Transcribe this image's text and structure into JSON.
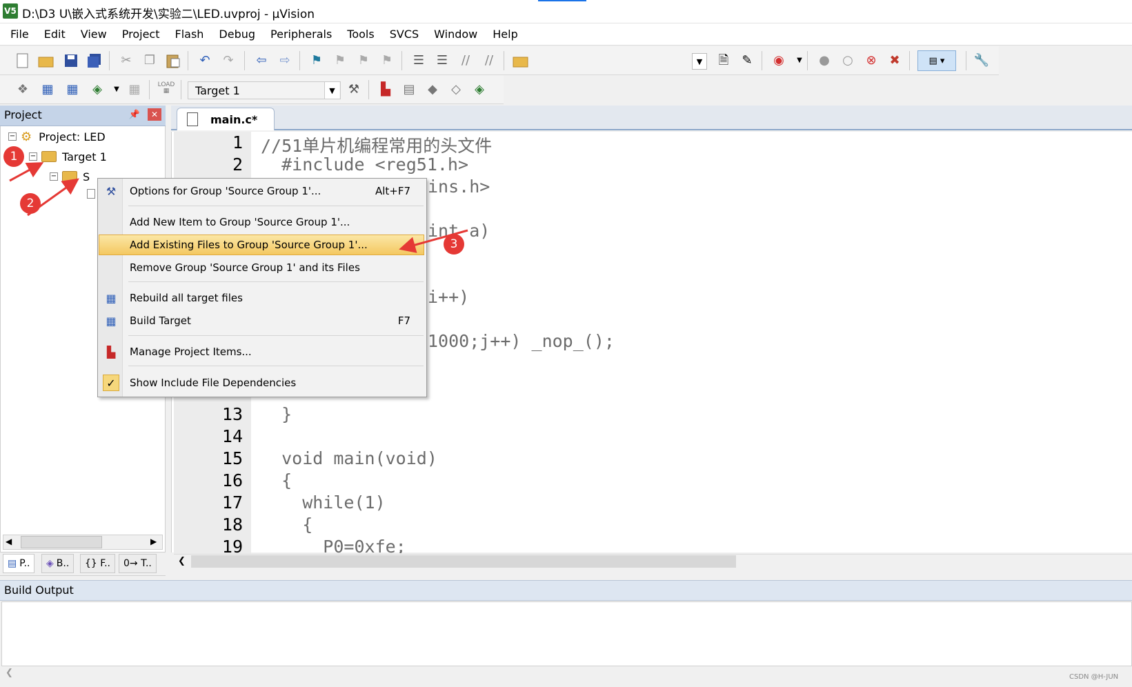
{
  "window": {
    "title": "D:\\D3 U\\嵌入式系统开发\\实验二\\LED.uvproj - µVision",
    "app_icon": "V5"
  },
  "menu": [
    "File",
    "Edit",
    "View",
    "Project",
    "Flash",
    "Debug",
    "Peripherals",
    "Tools",
    "SVCS",
    "Window",
    "Help"
  ],
  "toolbar2": {
    "target_value": "Target 1",
    "load_label": "LOAD"
  },
  "project_panel": {
    "header": "Project",
    "pin_icon": "pin-icon",
    "close_icon": "close-icon",
    "tree": {
      "project": "Project: LED",
      "target": "Target 1",
      "group_partial": "S"
    },
    "tabs": [
      "P..",
      "B..",
      "{} F..",
      "0→ T.."
    ]
  },
  "editor": {
    "tab_label": "main.c*",
    "lines": [
      {
        "n": "1",
        "code": "//51单片机编程常用的头文件"
      },
      {
        "n": "2",
        "code": "  #include <reg51.h>"
      },
      {
        "n": "13",
        "code": "  }"
      },
      {
        "n": "14",
        "code": ""
      },
      {
        "n": "15",
        "code": "  void main(void)"
      },
      {
        "n": "16",
        "code": "  {"
      },
      {
        "n": "17",
        "code": "    while(1)"
      },
      {
        "n": "18",
        "code": "    {"
      },
      {
        "n": "19",
        "code": "      P0=0xfe;"
      }
    ],
    "fragments": {
      "f3": "ins.h>",
      "f5": "int a)",
      "f8": "i++)",
      "f10": "1000;j++) _nop_();"
    }
  },
  "context_menu": {
    "items": [
      {
        "label": "Options for Group 'Source Group 1'...",
        "shortcut": "Alt+F7",
        "icon": "magic-wand-icon"
      },
      {
        "label": "Add New  Item to Group 'Source Group 1'...",
        "shortcut": "",
        "icon": ""
      },
      {
        "label": "Add Existing Files to Group 'Source Group 1'...",
        "shortcut": "",
        "icon": "",
        "highlighted": true
      },
      {
        "label": "Remove Group 'Source Group 1' and its Files",
        "shortcut": "",
        "icon": ""
      },
      {
        "label": "Rebuild all target files",
        "shortcut": "",
        "icon": "rebuild-icon"
      },
      {
        "label": "Build Target",
        "shortcut": "F7",
        "icon": "build-icon"
      },
      {
        "label": "Manage Project Items...",
        "shortcut": "",
        "icon": "manage-items-icon"
      },
      {
        "label": "Show Include File Dependencies",
        "shortcut": "",
        "icon": "checkmark-icon",
        "checked": true
      }
    ]
  },
  "build_output": {
    "header": "Build Output"
  },
  "annotations": {
    "b1": "1",
    "b2": "2",
    "b3": "3"
  },
  "watermark": "CSDN @H-JUN",
  "colors": {
    "accent": "#1a73e8",
    "highlight": "#f4c861",
    "annotation_red": "#e53935",
    "panel_header": "#c5d4e8"
  }
}
